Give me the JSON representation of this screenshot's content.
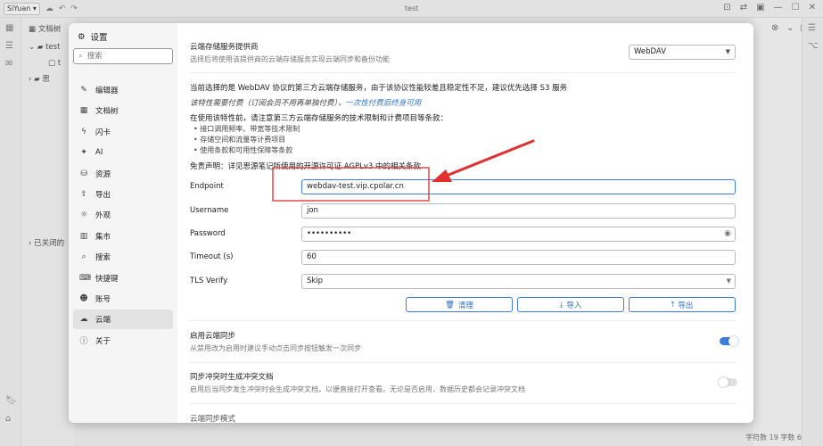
{
  "app": {
    "menu_label": "SiYuan",
    "window_title": "test"
  },
  "doc_panel": {
    "header": "文档树",
    "notebook": "test",
    "doc": "t",
    "other": "思",
    "closed": "已关闭的"
  },
  "settings": {
    "title": "设置",
    "search_placeholder": "搜索",
    "nav": [
      "编辑器",
      "文档树",
      "闪卡",
      "AI",
      "资源",
      "导出",
      "外观",
      "集市",
      "搜索",
      "快捷键",
      "账号",
      "云端",
      "关于"
    ],
    "active_nav": "云端"
  },
  "cloud": {
    "provider_title": "云端存储服务提供商",
    "provider_desc": "选择后将使用该提供商的云端存储服务实现云端同步和备份功能",
    "provider_value": "WebDAV",
    "notice_line1": "当前选择的是 WebDAV 协议的第三方云端存储服务，由于该协议性能较差且稳定性不足，建议优先选择 S3 服务",
    "notice_line2_em": "该特性需要付费（订阅会员不用再单独付费），",
    "notice_line2_link": "一次性付费后终身可用",
    "notice_line3": "在使用该特性前，请注意第三方云端存储服务的技术限制和计费项目等条款：",
    "bullets": [
      "接口调用频率、带宽等技术限制",
      "存储空间和流量等计费项目",
      "使用条款和可用性保障等条款"
    ],
    "disclaimer": "免责声明：详见思源笔记所使用的开源许可证 AGPLv3 中的相关条款",
    "endpoint_label": "Endpoint",
    "endpoint_value": "webdav-test.vip.cpolar.cn",
    "username_label": "Username",
    "username_value": "jon",
    "password_label": "Password",
    "password_value": "••••••••••",
    "timeout_label": "Timeout (s)",
    "timeout_value": "60",
    "tls_label": "TLS Verify",
    "tls_value": "Skip",
    "btn_clear": "清理",
    "btn_import": "导入",
    "btn_export": "导出",
    "sync_title": "启用云端同步",
    "sync_desc": "从禁用改为启用时建议手动点击同步按钮触发一次同步",
    "sync_on": true,
    "conflict_title": "同步冲突时生成冲突文档",
    "conflict_desc": "启用后当同步发生冲突时会生成冲突文档，以便直接打开查看。无论是否启用，数据历史都会记录冲突文档",
    "conflict_on": false,
    "cutoff_text": "云端同步模式"
  },
  "status": {
    "text": "字符数 19  字数 6"
  },
  "colors": {
    "accent": "#3b7de0",
    "annotation": "#e03030"
  }
}
